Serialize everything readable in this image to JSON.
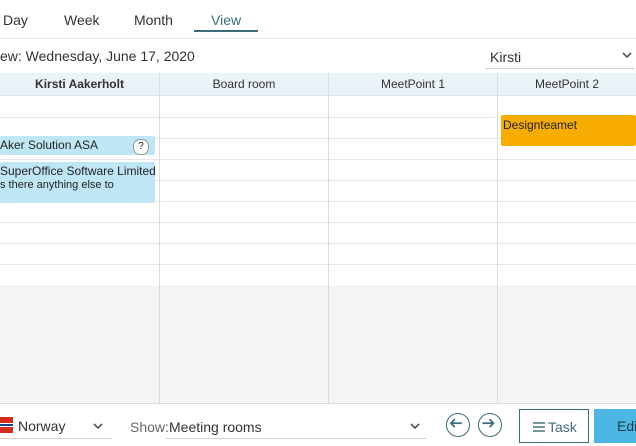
{
  "tabs": [
    {
      "label": "Day",
      "active": false
    },
    {
      "label": "Week",
      "active": false
    },
    {
      "label": "Month",
      "active": false
    },
    {
      "label": "View",
      "active": true
    }
  ],
  "view_title": "ew: Wednesday, June 17, 2020",
  "person_select": {
    "value": "Kirsti"
  },
  "columns": [
    "Kirsti Aakerholt",
    "Board room",
    "MeetPoint 1",
    "MeetPoint 2"
  ],
  "events": [
    {
      "title": "Aker Solution ASA",
      "badge": "?"
    },
    {
      "title": "SuperOffice Software Limited",
      "subtitle": "s there anything else to"
    },
    {
      "title": "Designteamet"
    }
  ],
  "footer": {
    "country": "Norway",
    "show_label": "Show:",
    "show_value": "Meeting rooms",
    "task_label": "Task",
    "edit_label": "Edi"
  },
  "colors": {
    "accent": "#3a6d79",
    "event_blue": "#bfe6f4",
    "event_orange": "#f6ad00",
    "edit_button": "#4cb7e3"
  }
}
